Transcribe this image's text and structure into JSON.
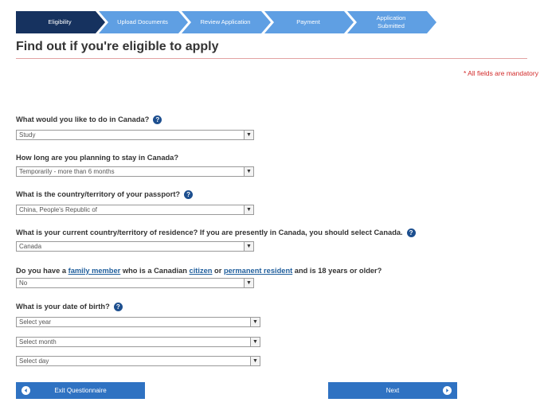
{
  "steps": [
    {
      "label": "Eligibility",
      "state": "current"
    },
    {
      "label": "Upload Documents",
      "state": "upcoming"
    },
    {
      "label": "Review Application",
      "state": "upcoming"
    },
    {
      "label": "Payment",
      "state": "upcoming"
    },
    {
      "label": "Application\nSubmitted",
      "state": "upcoming"
    }
  ],
  "page": {
    "title": "Find out if you're eligible to apply",
    "mandatory_note": "* All fields are mandatory"
  },
  "questions": {
    "activity": {
      "label": "What would you like to do in Canada?",
      "value": "Study",
      "help_icon": "question-circle-icon"
    },
    "duration": {
      "label": "How long are you planning to stay in Canada?",
      "value": "Temporarily - more than 6 months"
    },
    "passport": {
      "label": "What is the country/territory of your passport?",
      "value": "China, People's Republic of",
      "help_icon": "question-circle-icon"
    },
    "residence": {
      "label": "What is your current country/territory of residence? If you are presently in Canada, you should select Canada.",
      "value": "Canada",
      "help_icon": "question-circle-icon"
    },
    "family": {
      "label_parts": [
        "Do you have a ",
        "family member",
        " who is a Canadian ",
        "citizen",
        " or ",
        "permanent resident",
        " and is 18 years or older?"
      ],
      "value": "No"
    },
    "dob": {
      "label": "What is your date of birth?",
      "help_icon": "question-circle-icon",
      "year_placeholder": "Select year",
      "month_placeholder": "Select month",
      "day_placeholder": "Select day"
    }
  },
  "buttons": {
    "exit": "Exit Questionnaire",
    "next": "Next"
  },
  "colors": {
    "step_current": "#16325f",
    "step_upcoming": "#5f9fe3",
    "button": "#2f72c2",
    "mandatory": "#d22a2a",
    "link": "#1f5e9c"
  }
}
